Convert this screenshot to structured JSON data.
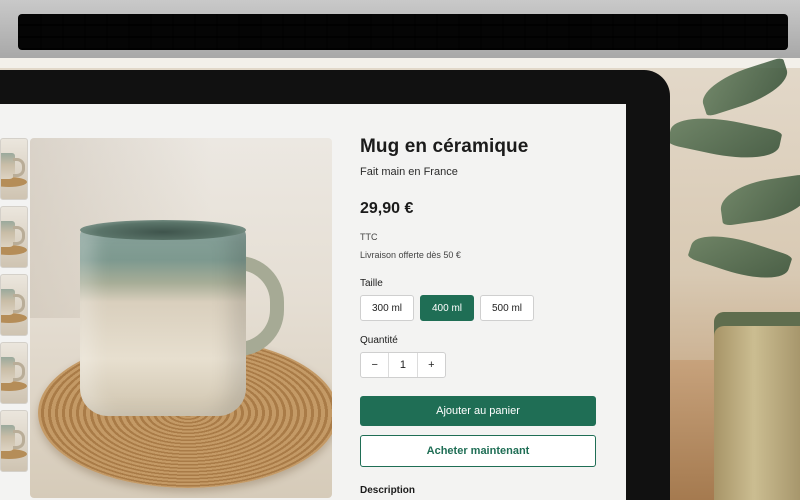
{
  "product": {
    "title": "Mug en céramique",
    "subtitle": "Fait main en France",
    "price": "29,90 €",
    "tax_note": "TTC",
    "shipping_note": "Livraison offerte dès 50 €"
  },
  "size": {
    "label": "Taille",
    "options": [
      "300 ml",
      "400 ml",
      "500 ml"
    ],
    "selected": "400 ml"
  },
  "quantity": {
    "label": "Quantité",
    "minus": "−",
    "value": "1",
    "plus": "+"
  },
  "actions": {
    "add_to_cart": "Ajouter au panier",
    "buy_now": "Acheter maintenant"
  },
  "description": {
    "label": "Description"
  },
  "colors": {
    "accent": "#1f6e55",
    "background": "#f3f3f2"
  },
  "gallery": {
    "thumbnail_icons": [
      "mug-thumbnail",
      "mug-thumbnail",
      "mug-thumbnail",
      "mug-thumbnail",
      "mug-thumbnail"
    ]
  }
}
